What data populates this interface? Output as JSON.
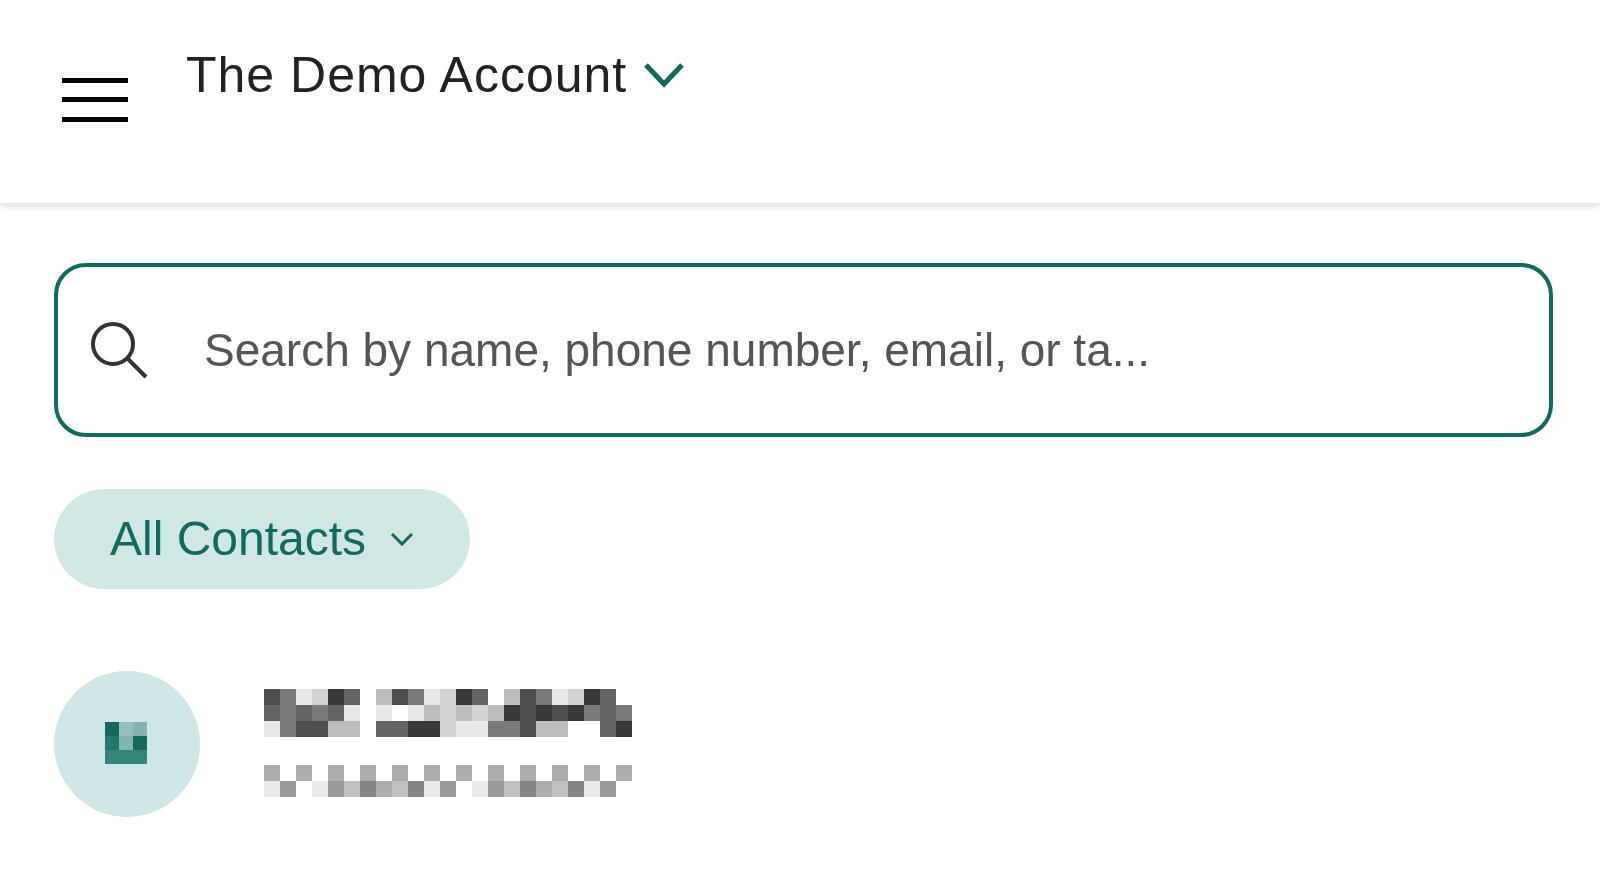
{
  "header": {
    "account_name": "The Demo Account"
  },
  "search": {
    "placeholder": "Search by name, phone number, email, or ta..."
  },
  "filter": {
    "label": "All Contacts"
  },
  "contacts": [
    {
      "kind": "redacted"
    }
  ]
}
